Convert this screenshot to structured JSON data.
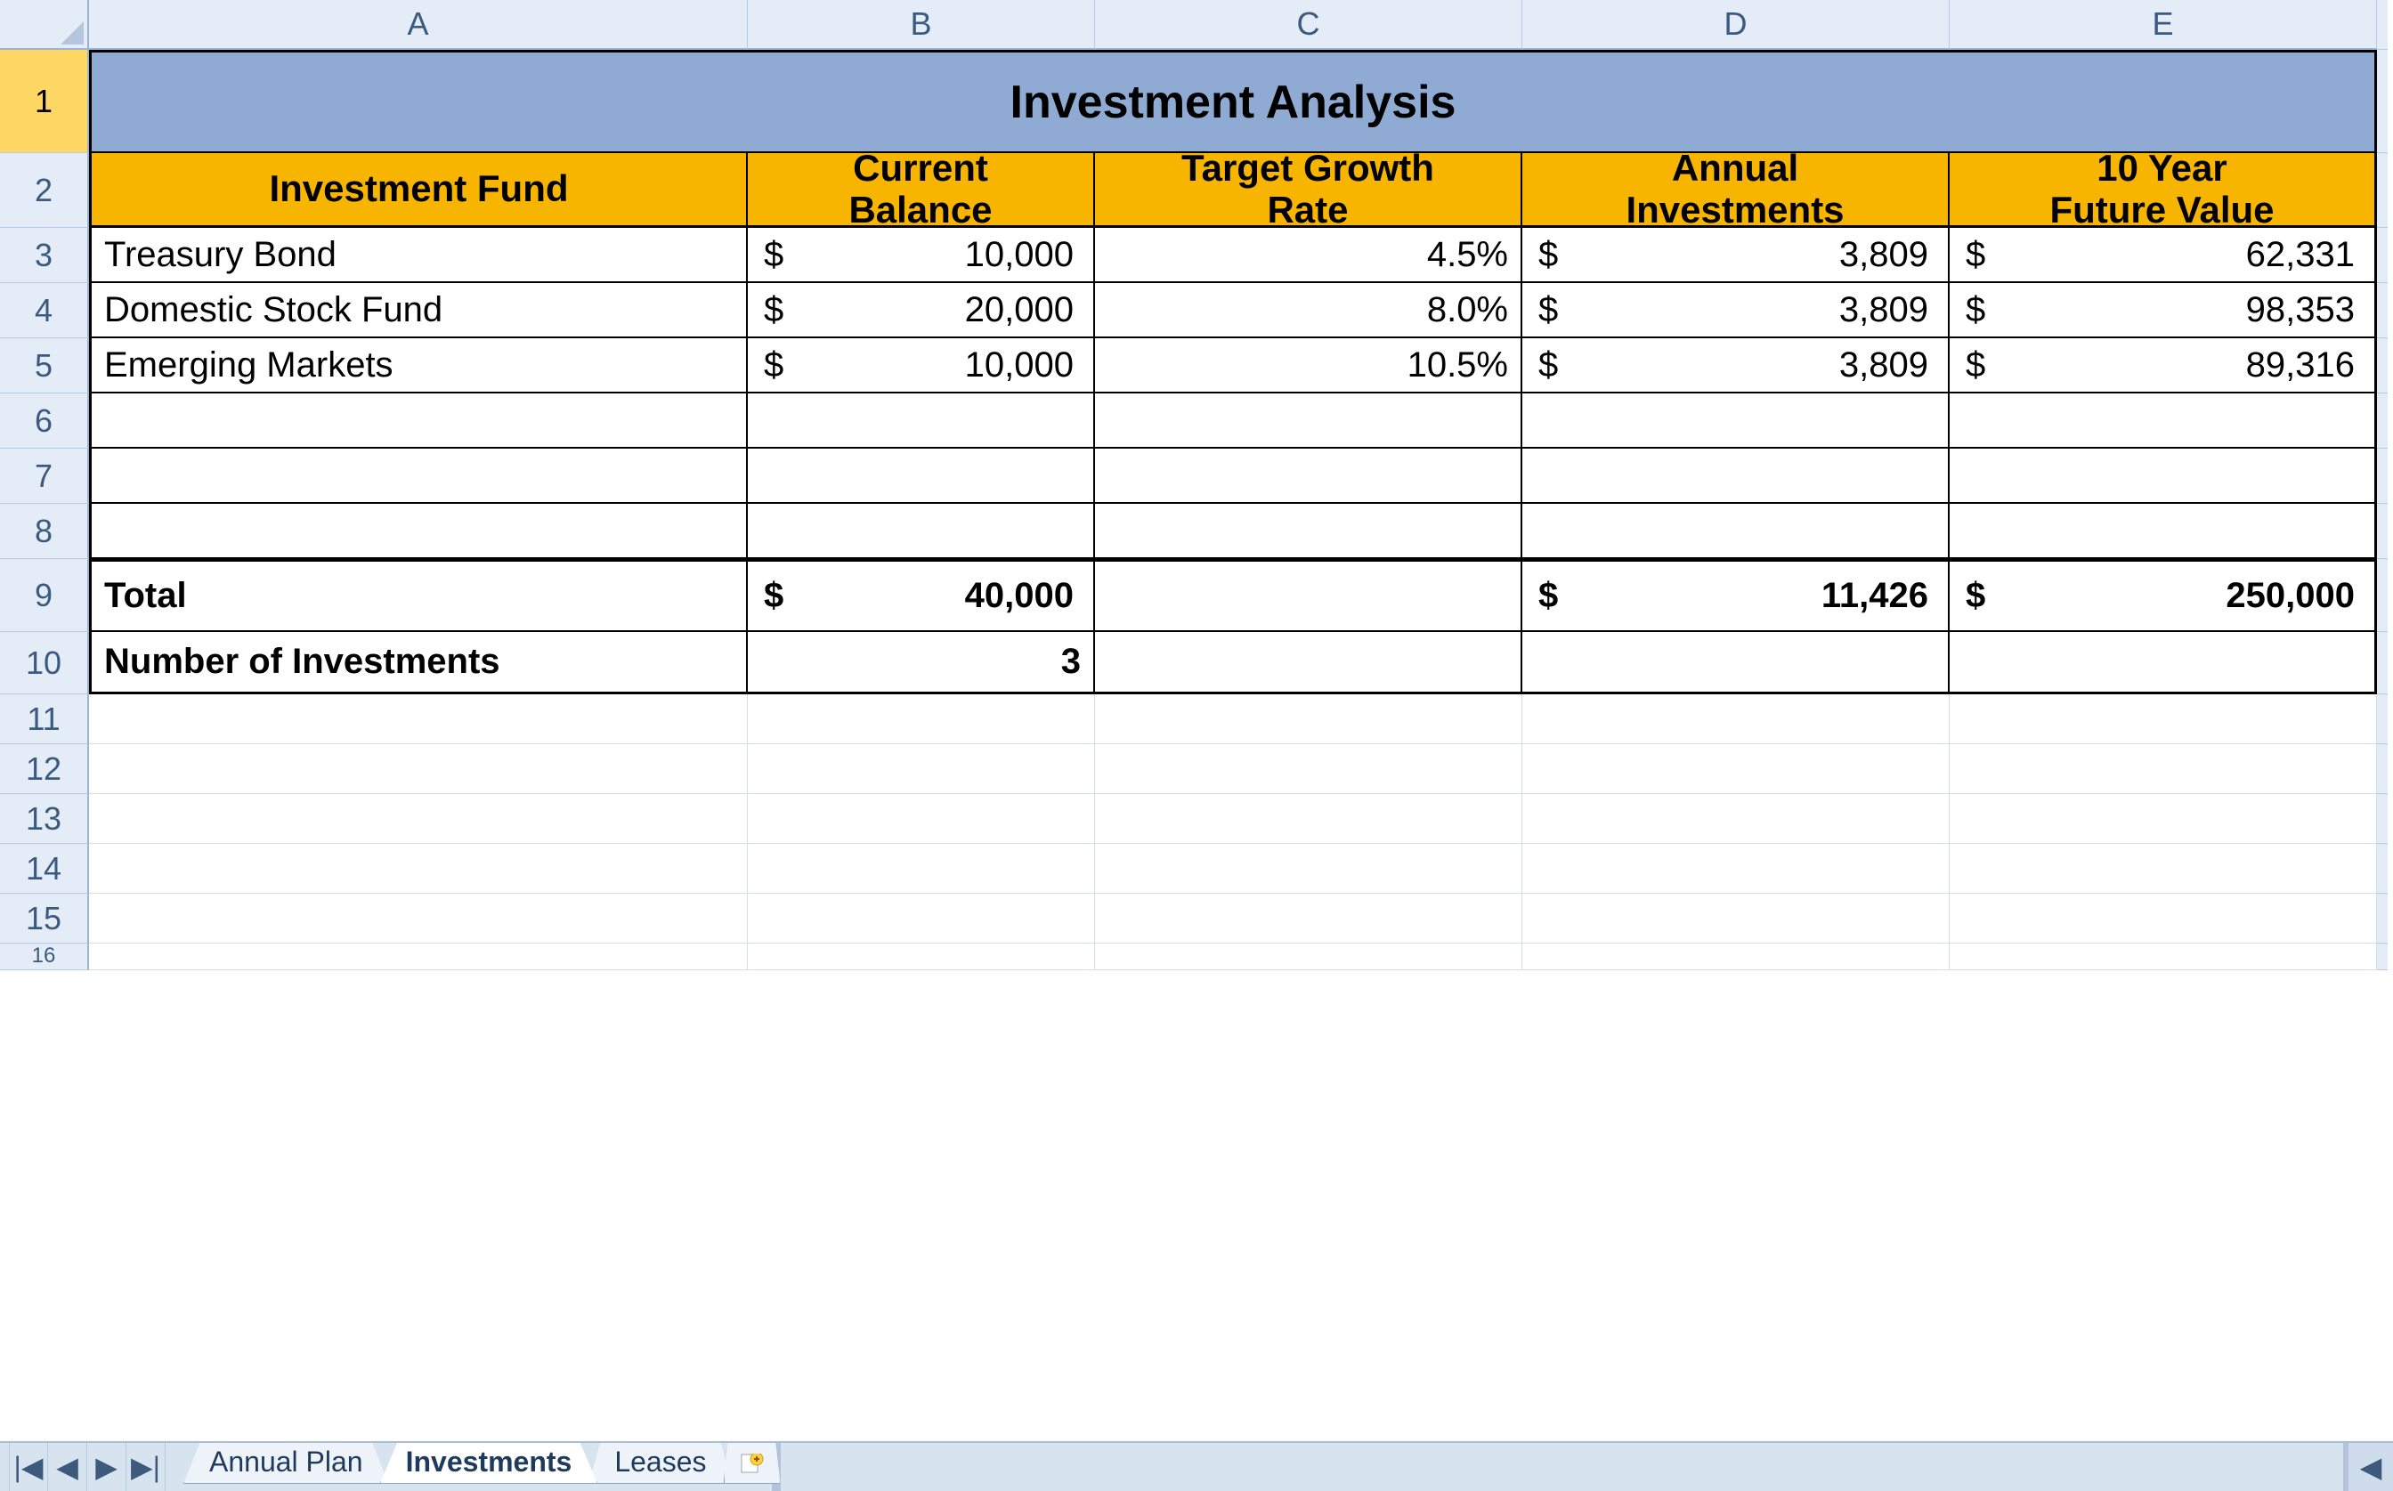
{
  "columns": [
    "A",
    "B",
    "C",
    "D",
    "E"
  ],
  "title": "Investment Analysis",
  "headers": {
    "A": "Investment Fund",
    "B": "Current\nBalance",
    "C": "Target Growth\nRate",
    "D": "Annual\nInvestments",
    "E": "10 Year\nFuture Value"
  },
  "rows": [
    {
      "fund": "Treasury Bond",
      "balance": "10,000",
      "rate": "4.5%",
      "annual": "3,809",
      "future": "62,331"
    },
    {
      "fund": "Domestic Stock Fund",
      "balance": "20,000",
      "rate": "8.0%",
      "annual": "3,809",
      "future": "98,353"
    },
    {
      "fund": "Emerging Markets",
      "balance": "10,000",
      "rate": "10.5%",
      "annual": "3,809",
      "future": "89,316"
    }
  ],
  "total": {
    "label": "Total",
    "balance": "40,000",
    "annual": "11,426",
    "future": "250,000"
  },
  "numInv": {
    "label": "Number of Investments",
    "value": "3"
  },
  "currency": "$",
  "tabs": {
    "t1": "Annual Plan",
    "t2": "Investments",
    "t3": "Leases"
  },
  "nav": {
    "first": "▏◀",
    "prev": "◀",
    "next": "▶",
    "last": "▶▏"
  }
}
